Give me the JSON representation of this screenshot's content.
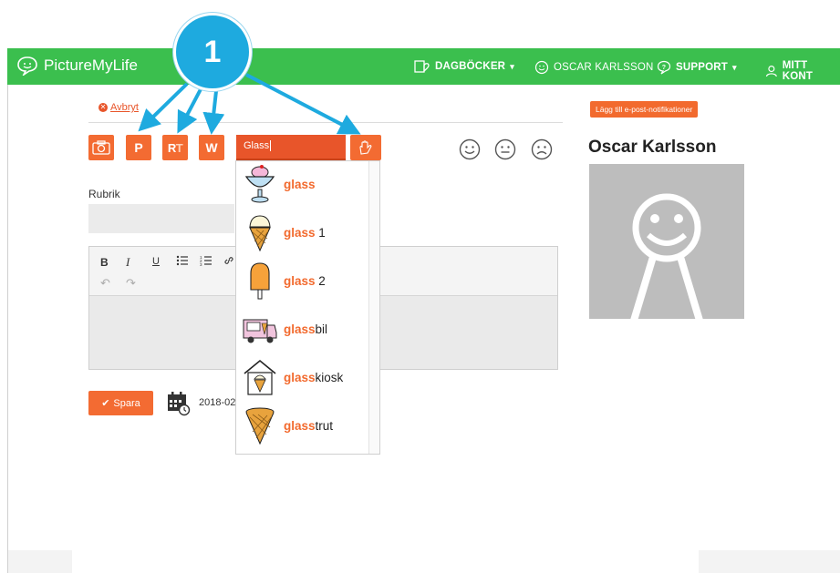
{
  "navbar": {
    "brand": "PictureMyLife",
    "diaries": "DAGBÖCKER",
    "user": "OSCAR KARLSSON",
    "support": "SUPPORT",
    "account": "MITT KONT"
  },
  "annotation": {
    "number": "1"
  },
  "form": {
    "cancel": "Avbryt",
    "notify": "Lägg till e-post-notifikationer",
    "tools": {
      "photo": "camera-icon",
      "p": "P",
      "rt_r": "R",
      "rt_t": "T",
      "w": "W"
    },
    "search_value": "Glass",
    "rubrik_label": "Rubrik",
    "save": "Spara",
    "date": "2018-02"
  },
  "suggestions": [
    {
      "match": "glass",
      "rest": "",
      "icon": "ice-cream-sundae-icon"
    },
    {
      "match": "glass",
      "rest": " 1",
      "icon": "ice-cream-cone-icon"
    },
    {
      "match": "glass",
      "rest": " 2",
      "icon": "popsicle-icon"
    },
    {
      "match": "glass",
      "rest": "bil",
      "icon": "ice-cream-truck-icon"
    },
    {
      "match": "glass",
      "rest": "kiosk",
      "icon": "ice-cream-kiosk-icon"
    },
    {
      "match": "glass",
      "rest": "trut",
      "icon": "wafer-cone-icon"
    }
  ],
  "profile": {
    "name": "Oscar Karlsson"
  },
  "colors": {
    "nav_green": "#3bbf4e",
    "accent_orange": "#f36b32",
    "callout_blue": "#1eaadf"
  }
}
